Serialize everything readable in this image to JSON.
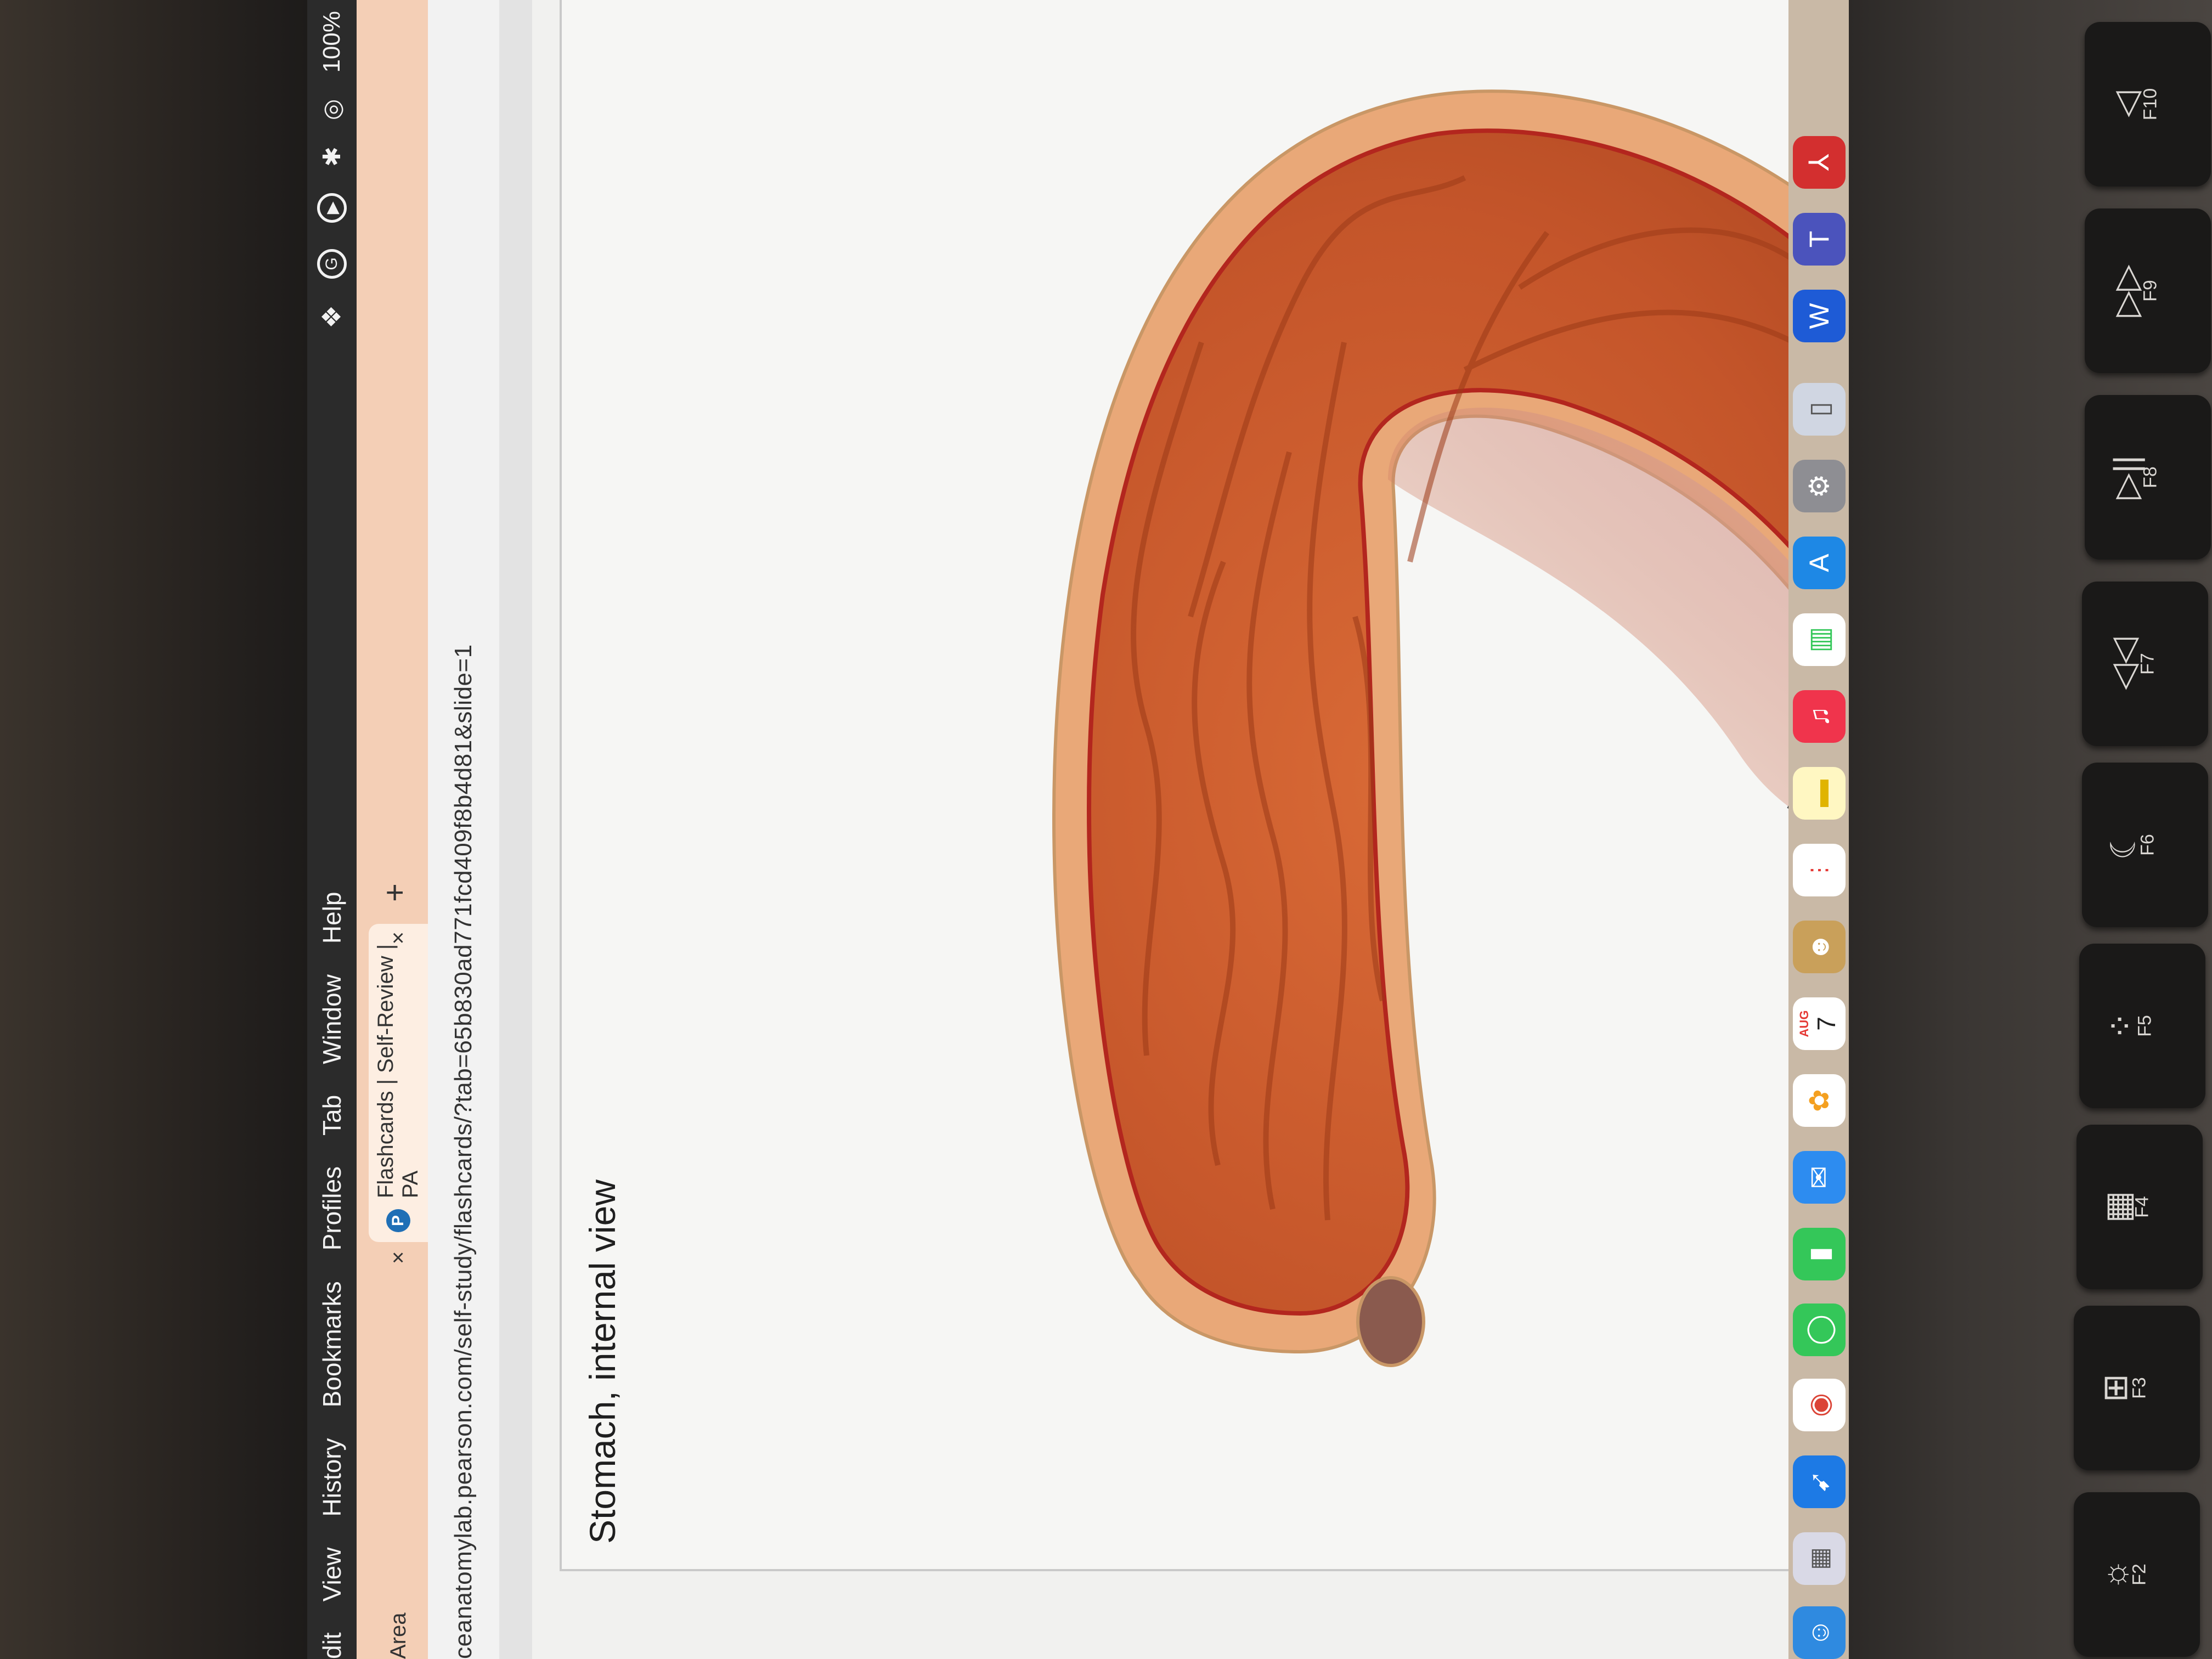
{
  "menubar": {
    "items": [
      "dit",
      "View",
      "History",
      "Bookmarks",
      "Profiles",
      "Tab",
      "Window",
      "Help"
    ],
    "battery": "100%"
  },
  "tabs": {
    "left_tab_label": "Area",
    "active_tab_label": "Flashcards | Self-Review | PA",
    "close_symbol": "×",
    "new_tab_symbol": "+"
  },
  "url": "ceanatomylab.pearson.com/self-study/flashcards/?tab=65b830ad771fcd409f8b4d81&slide=1",
  "card": {
    "title": "Stomach, internal view"
  },
  "dock": {
    "calendar_month": "AUG",
    "calendar_day": "7"
  },
  "keyboard": {
    "keys": [
      {
        "label": "F2",
        "symbol": "☼"
      },
      {
        "label": "F3",
        "symbol": "⊞"
      },
      {
        "label": "F4",
        "symbol": "▦"
      },
      {
        "label": "F5",
        "symbol": "⁘"
      },
      {
        "label": "F6",
        "symbol": "☾"
      },
      {
        "label": "F7",
        "symbol": "◁◁"
      },
      {
        "label": "F8",
        "symbol": "▷||"
      },
      {
        "label": "F9",
        "symbol": "▷▷"
      },
      {
        "label": "F10",
        "symbol": "◁"
      }
    ]
  },
  "colors": {
    "tab_bar": "#f4cfb6",
    "stomach_outer": "#e9a878",
    "stomach_mucosa": "#c8592c",
    "pylorus_marker": "#a99ab5"
  }
}
